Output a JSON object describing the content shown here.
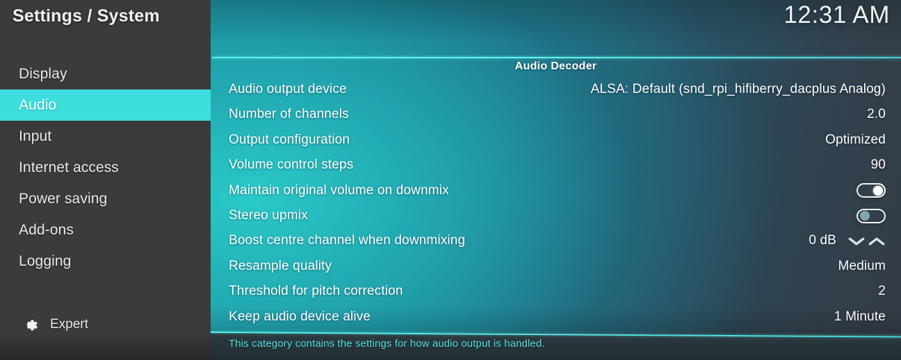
{
  "header": {
    "title": "Settings / System",
    "clock": "12:31 AM"
  },
  "sidebar": {
    "items": [
      {
        "label": "Display",
        "selected": false
      },
      {
        "label": "Audio",
        "selected": true
      },
      {
        "label": "Input",
        "selected": false
      },
      {
        "label": "Internet access",
        "selected": false
      },
      {
        "label": "Power saving",
        "selected": false
      },
      {
        "label": "Add-ons",
        "selected": false
      },
      {
        "label": "Logging",
        "selected": false
      }
    ],
    "expert": {
      "label": "Expert",
      "icon": "gear-icon"
    }
  },
  "main": {
    "section_header": "Audio Decoder",
    "rows": [
      {
        "label": "Audio output device",
        "type": "value",
        "value": "ALSA: Default (snd_rpi_hifiberry_dacplus Analog)"
      },
      {
        "label": "Number of channels",
        "type": "value",
        "value": "2.0"
      },
      {
        "label": "Output configuration",
        "type": "value",
        "value": "Optimized"
      },
      {
        "label": "Volume control steps",
        "type": "value",
        "value": "90"
      },
      {
        "label": "Maintain original volume on downmix",
        "type": "toggle",
        "value": "on"
      },
      {
        "label": "Stereo upmix",
        "type": "toggle",
        "value": "off"
      },
      {
        "label": "Boost centre channel when downmixing",
        "type": "spinner",
        "value": "0 dB"
      },
      {
        "label": "Resample quality",
        "type": "value",
        "value": "Medium"
      },
      {
        "label": "Threshold for pitch correction",
        "type": "value",
        "value": "2"
      },
      {
        "label": "Keep audio device alive",
        "type": "value",
        "value": "1 Minute"
      },
      {
        "label": "",
        "type": "toggle",
        "value": "on"
      }
    ]
  },
  "footer": {
    "description": "This category contains the settings for how audio output is handled."
  },
  "colors": {
    "accent": "#3fdede",
    "sidebar_bg": "#3b3b3b",
    "content_teal": "#1f8f9c",
    "content_slate": "#343b44",
    "footer_text": "#53dfe0"
  }
}
